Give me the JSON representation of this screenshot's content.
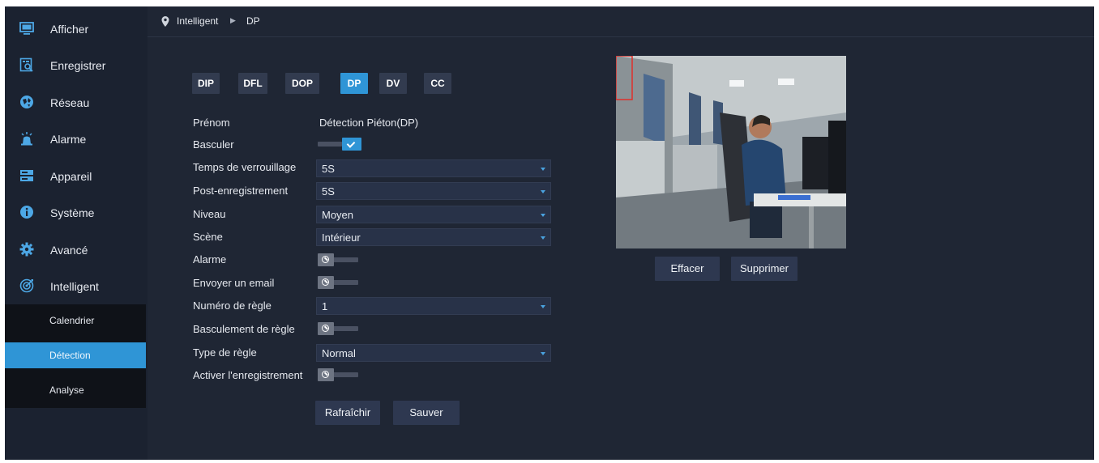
{
  "sidebar": {
    "items": [
      {
        "label": "Afficher",
        "icon": "monitor-icon"
      },
      {
        "label": "Enregistrer",
        "icon": "record-search-icon"
      },
      {
        "label": "Réseau",
        "icon": "network-globe-icon"
      },
      {
        "label": "Alarme",
        "icon": "alarm-icon"
      },
      {
        "label": "Appareil",
        "icon": "device-storage-icon"
      },
      {
        "label": "Système",
        "icon": "info-icon"
      },
      {
        "label": "Avancé",
        "icon": "gear-icon"
      },
      {
        "label": "Intelligent",
        "icon": "intelligent-target-icon"
      }
    ],
    "subitems": [
      {
        "label": "Calendrier"
      },
      {
        "label": "Détection",
        "active": true
      },
      {
        "label": "Analyse"
      }
    ]
  },
  "breadcrumb": {
    "parent": "Intelligent",
    "current": "DP"
  },
  "tabs": [
    {
      "label": "DIP"
    },
    {
      "label": "DFL"
    },
    {
      "label": "DOP"
    },
    {
      "label": "DP",
      "active": true
    },
    {
      "label": "DV"
    },
    {
      "label": "CC"
    }
  ],
  "form": {
    "name": {
      "label": "Prénom",
      "value": "Détection Piéton(DP)"
    },
    "switch": {
      "label": "Basculer",
      "on": true
    },
    "lock_time": {
      "label": "Temps de verrouillage",
      "value": "5S"
    },
    "post_record": {
      "label": "Post-enregistrement",
      "value": "5S"
    },
    "level": {
      "label": "Niveau",
      "value": "Moyen"
    },
    "scene": {
      "label": "Scène",
      "value": "Intérieur"
    },
    "alarm": {
      "label": "Alarme",
      "on": false
    },
    "email": {
      "label": "Envoyer un email",
      "on": false
    },
    "rule_number": {
      "label": "Numéro de règle",
      "value": "1"
    },
    "rule_switch": {
      "label": "Basculement de règle",
      "on": false
    },
    "rule_type": {
      "label": "Type de règle",
      "value": "Normal"
    },
    "enable_record": {
      "label": "Activer l'enregistrement",
      "on": false
    }
  },
  "buttons": {
    "refresh": "Rafraîchir",
    "save": "Sauver",
    "clear": "Effacer",
    "delete": "Supprimer"
  },
  "colors": {
    "accent": "#2f95d6",
    "background": "#1f2634",
    "sidebar": "#1b2230",
    "submenu": "#0f1218"
  }
}
